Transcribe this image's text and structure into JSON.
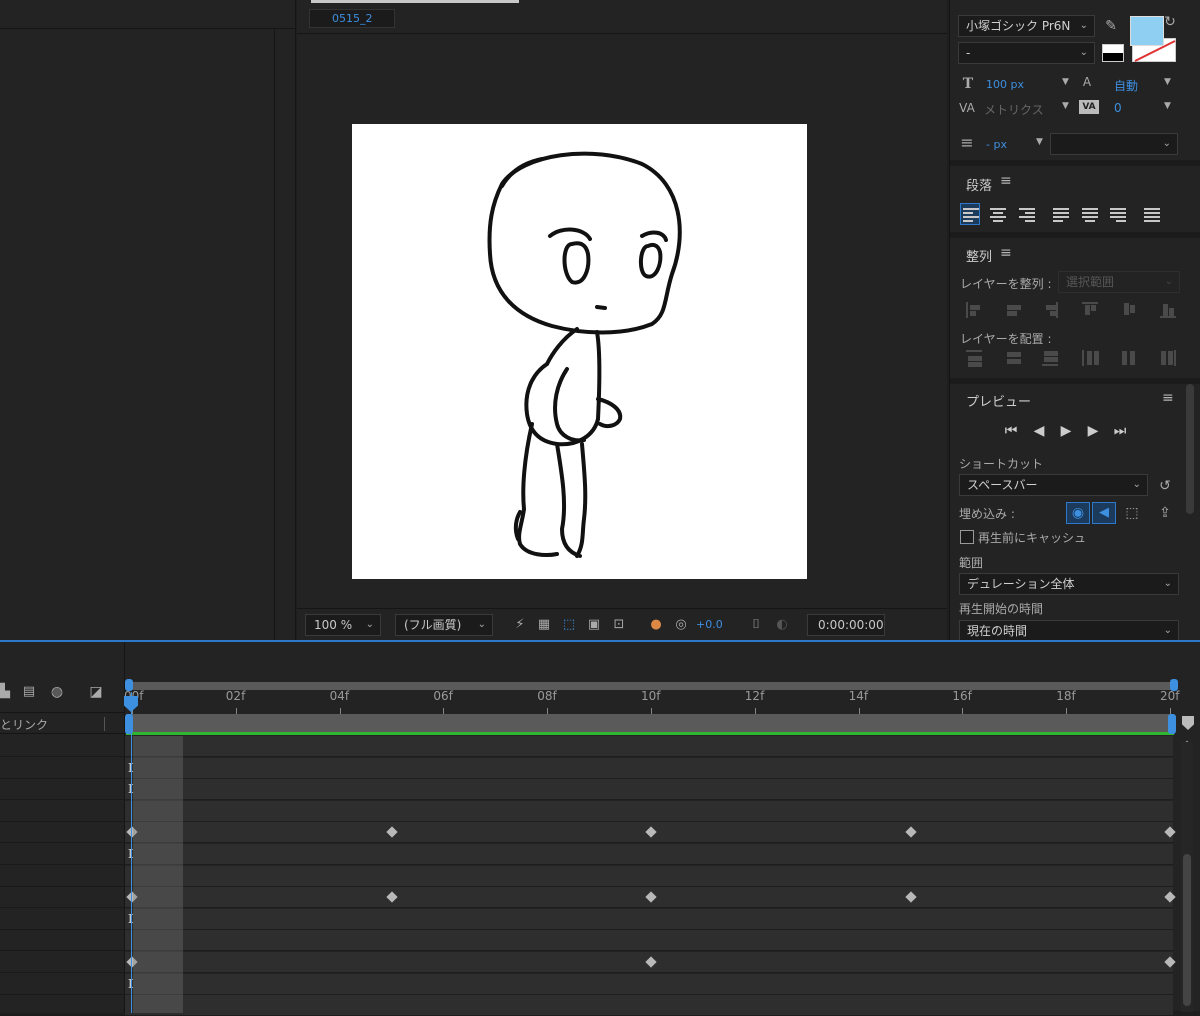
{
  "comp_viewer": {
    "comp_tab": "0515_2",
    "zoom": "100 %",
    "resolution": "(フル画質)",
    "exposure": "+0.0",
    "timecode": "0:00:00:00"
  },
  "character_panel": {
    "font_family": "小塚ゴシック Pr6N",
    "font_style": "-",
    "font_size": "100 px",
    "leading": "自動",
    "kerning": "メトリクス",
    "tracking": "0",
    "stroke_width": "- px",
    "fill_color": "#8ecff2"
  },
  "paragraph_panel": {
    "title": "段落"
  },
  "align_panel": {
    "title": "整列",
    "align_layers_label": "レイヤーを整列 :",
    "align_target": "選択範囲",
    "distribute_label": "レイヤーを配置 :"
  },
  "preview_panel": {
    "title": "プレビュー",
    "shortcut_label": "ショートカット",
    "shortcut_value": "スペースバー",
    "include_label": "埋め込み :",
    "cache_label": "再生前にキャッシュ",
    "range_label": "範囲",
    "range_value": "デュレーション全体",
    "start_label": "再生開始の時間",
    "start_value": "現在の時間"
  },
  "timeline": {
    "parent_link_label": "とリンク",
    "ruler_labels": [
      "00f",
      "02f",
      "04f",
      "06f",
      "08f",
      "10f",
      "12f",
      "14f",
      "16f",
      "18f",
      "20f"
    ],
    "accent": "#2d78c8",
    "work_area_color": "#2fb52f"
  }
}
